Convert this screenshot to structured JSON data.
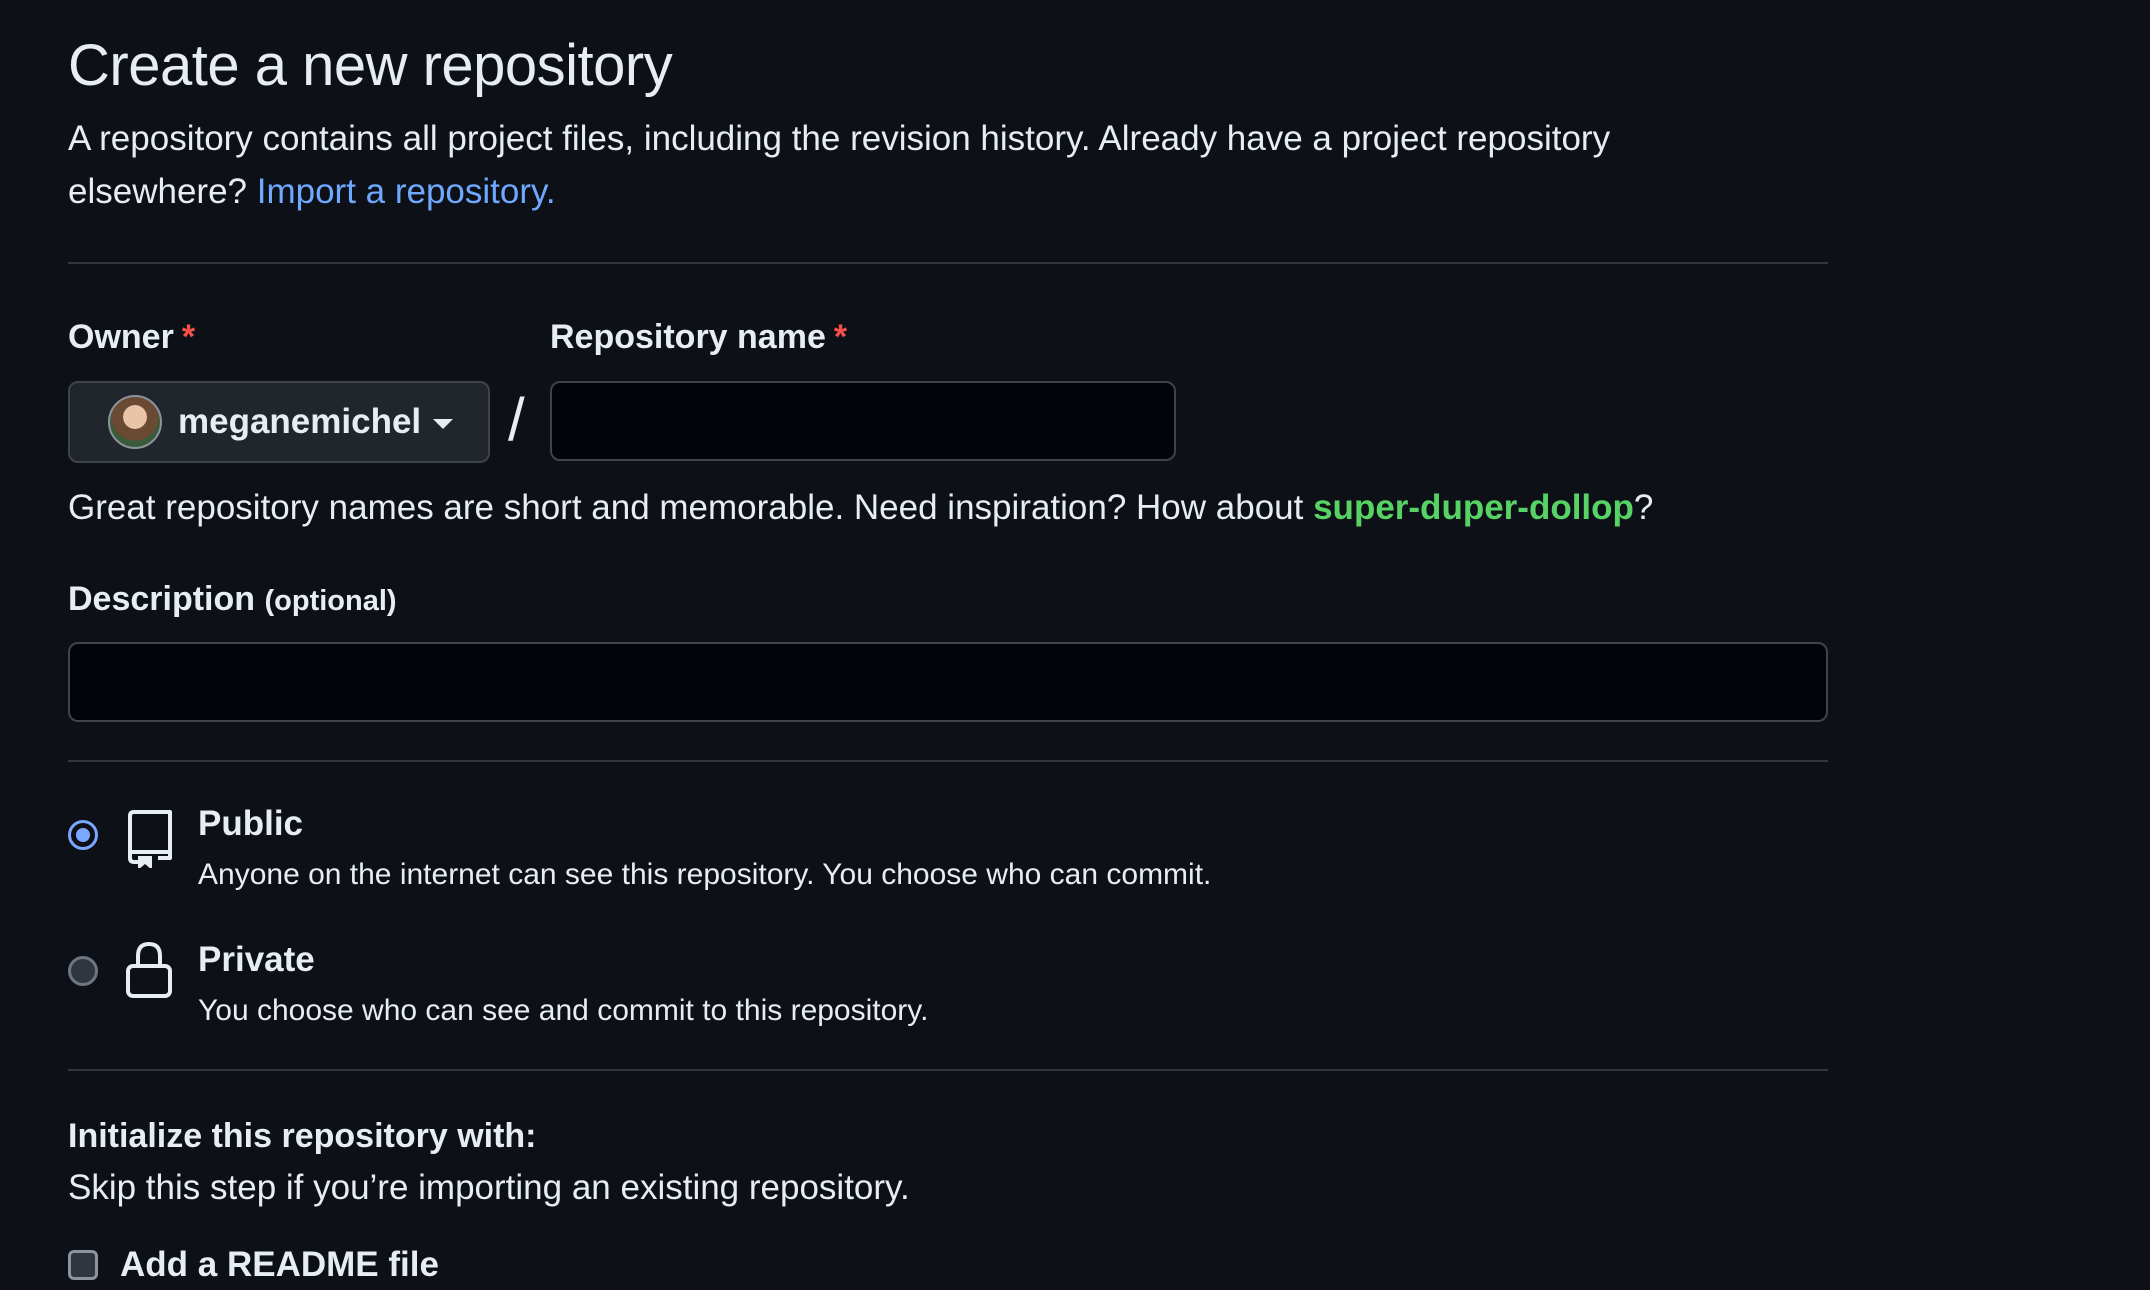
{
  "header": {
    "title": "Create a new repository",
    "subtitle_text": "A repository contains all project files, including the revision history. Already have a project repository elsewhere?",
    "import_link": "Import a repository."
  },
  "owner": {
    "label": "Owner",
    "required_mark": "*",
    "selected": "meganemichel"
  },
  "separator": "/",
  "repo_name": {
    "label": "Repository name",
    "required_mark": "*",
    "value": "",
    "placeholder": ""
  },
  "hint": {
    "text": "Great repository names are short and memorable. Need inspiration? How about",
    "suggestion": "super-duper-dollop",
    "suffix": "?"
  },
  "description": {
    "label": "Description",
    "optional": "(optional)",
    "value": "",
    "placeholder": ""
  },
  "visibility": {
    "options": [
      {
        "title": "Public",
        "desc": "Anyone on the internet can see this repository. You choose who can commit.",
        "selected": true,
        "icon": "repo-icon"
      },
      {
        "title": "Private",
        "desc": "You choose who can see and commit to this repository.",
        "selected": false,
        "icon": "lock-icon"
      }
    ]
  },
  "initialize": {
    "title": "Initialize this repository with:",
    "desc": "Skip this step if you’re importing an existing repository.",
    "readme_label": "Add a README file",
    "readme_checked": false
  },
  "colors": {
    "background": "#0d1117",
    "link": "#6ea8ff",
    "suggestion": "#56d364",
    "required": "#f85149",
    "radio_accent": "#7aa7ff"
  }
}
